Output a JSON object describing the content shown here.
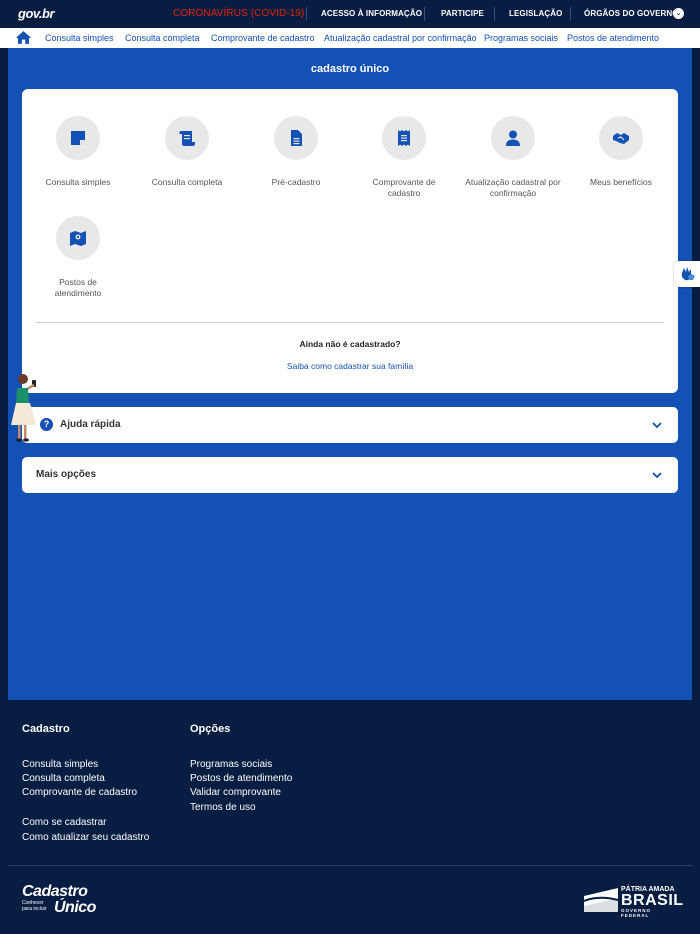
{
  "govbar": {
    "logo": "gov.br",
    "covid": "CORONAVÍRUS (COVID-19)",
    "links": [
      "ACESSO À INFORMAÇÃO",
      "PARTICIPE",
      "LEGISLAÇÃO",
      "ÓRGÃOS DO GOVERNO"
    ]
  },
  "nav": {
    "links": [
      "Consulta simples",
      "Consulta completa",
      "Comprovante de cadastro",
      "Atualização cadastral por confirmação",
      "Programas sociais",
      "Postos de atendimento"
    ]
  },
  "main": {
    "title": "cadastro único",
    "services": [
      {
        "label": "Consulta simples",
        "icon": "sticky-note-icon"
      },
      {
        "label": "Consulta completa",
        "icon": "scroll-icon"
      },
      {
        "label": "Pré-cadastro",
        "icon": "document-icon"
      },
      {
        "label": "Comprovante de cadastro",
        "icon": "receipt-icon"
      },
      {
        "label": "Atualização cadastral por confirmação",
        "icon": "user-icon"
      },
      {
        "label": "Meus benefícios",
        "icon": "handshake-icon"
      },
      {
        "label": "Postos de atendimento",
        "icon": "map-icon"
      }
    ],
    "not_registered": "Ainda não é cadastrado?",
    "how_to_register": "Saiba como cadastrar sua família"
  },
  "accordions": [
    {
      "label": "Ajuda rápida"
    },
    {
      "label": "Mais opções"
    }
  ],
  "footer": {
    "col1": {
      "heading": "Cadastro",
      "links": [
        "Consulta simples",
        "Consulta completa",
        "Comprovante de cadastro",
        "Como se cadastrar",
        "Como atualizar seu cadastro"
      ]
    },
    "col2": {
      "heading": "Opções",
      "links": [
        "Programas sociais",
        "Postos de atendimento",
        "Validar comprovante",
        "Termos de uso"
      ]
    },
    "logo": {
      "line1": "Cadastro",
      "tagline": "Conhecer para incluir",
      "line2": "Único"
    },
    "brasil": {
      "top": "PÁTRIA AMADA",
      "main": "BRASIL",
      "sub": "GOVERNO FEDERAL"
    }
  },
  "colors": {
    "primary": "#1351b4",
    "dark": "#071d41",
    "covid": "#e52207"
  }
}
